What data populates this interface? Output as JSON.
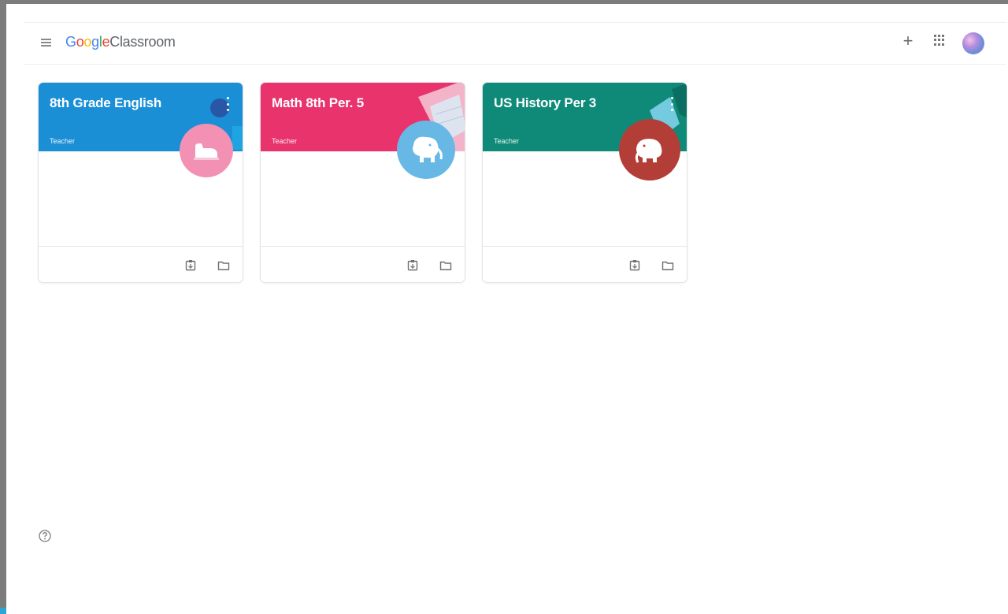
{
  "app": {
    "brand": {
      "part1": "G",
      "part2": "o",
      "part3": "o",
      "part4": "g",
      "part5": "l",
      "part6": "e",
      "product": "Classroom"
    },
    "menu_icon": "hamburger-menu-icon",
    "actions": {
      "create_icon": "plus-icon",
      "apps_icon": "apps-grid-icon",
      "account_icon": "account-avatar"
    }
  },
  "classes": [
    {
      "title": "8th Grade English",
      "role": "Teacher",
      "header_color": "#1a8fd6",
      "avatar_color": "#f291b3",
      "avatar_icon": "shoe-icon",
      "menu_icon": "more-vert-icon",
      "footer_icons": [
        "assignment-icon",
        "folder-icon"
      ]
    },
    {
      "title": "Math 8th Per. 5",
      "role": "Teacher",
      "header_color": "#e8336d",
      "avatar_color": "#68b8e5",
      "avatar_icon": "elephant-icon",
      "menu_icon": "more-vert-icon",
      "footer_icons": [
        "assignment-icon",
        "folder-icon"
      ]
    },
    {
      "title": "US History Per 3",
      "role": "Teacher",
      "header_color": "#0f8a78",
      "avatar_color": "#b33e37",
      "avatar_icon": "elephant-icon",
      "menu_icon": "more-vert-icon",
      "footer_icons": [
        "assignment-icon",
        "folder-icon"
      ]
    }
  ],
  "help_icon": "help-circle-icon"
}
